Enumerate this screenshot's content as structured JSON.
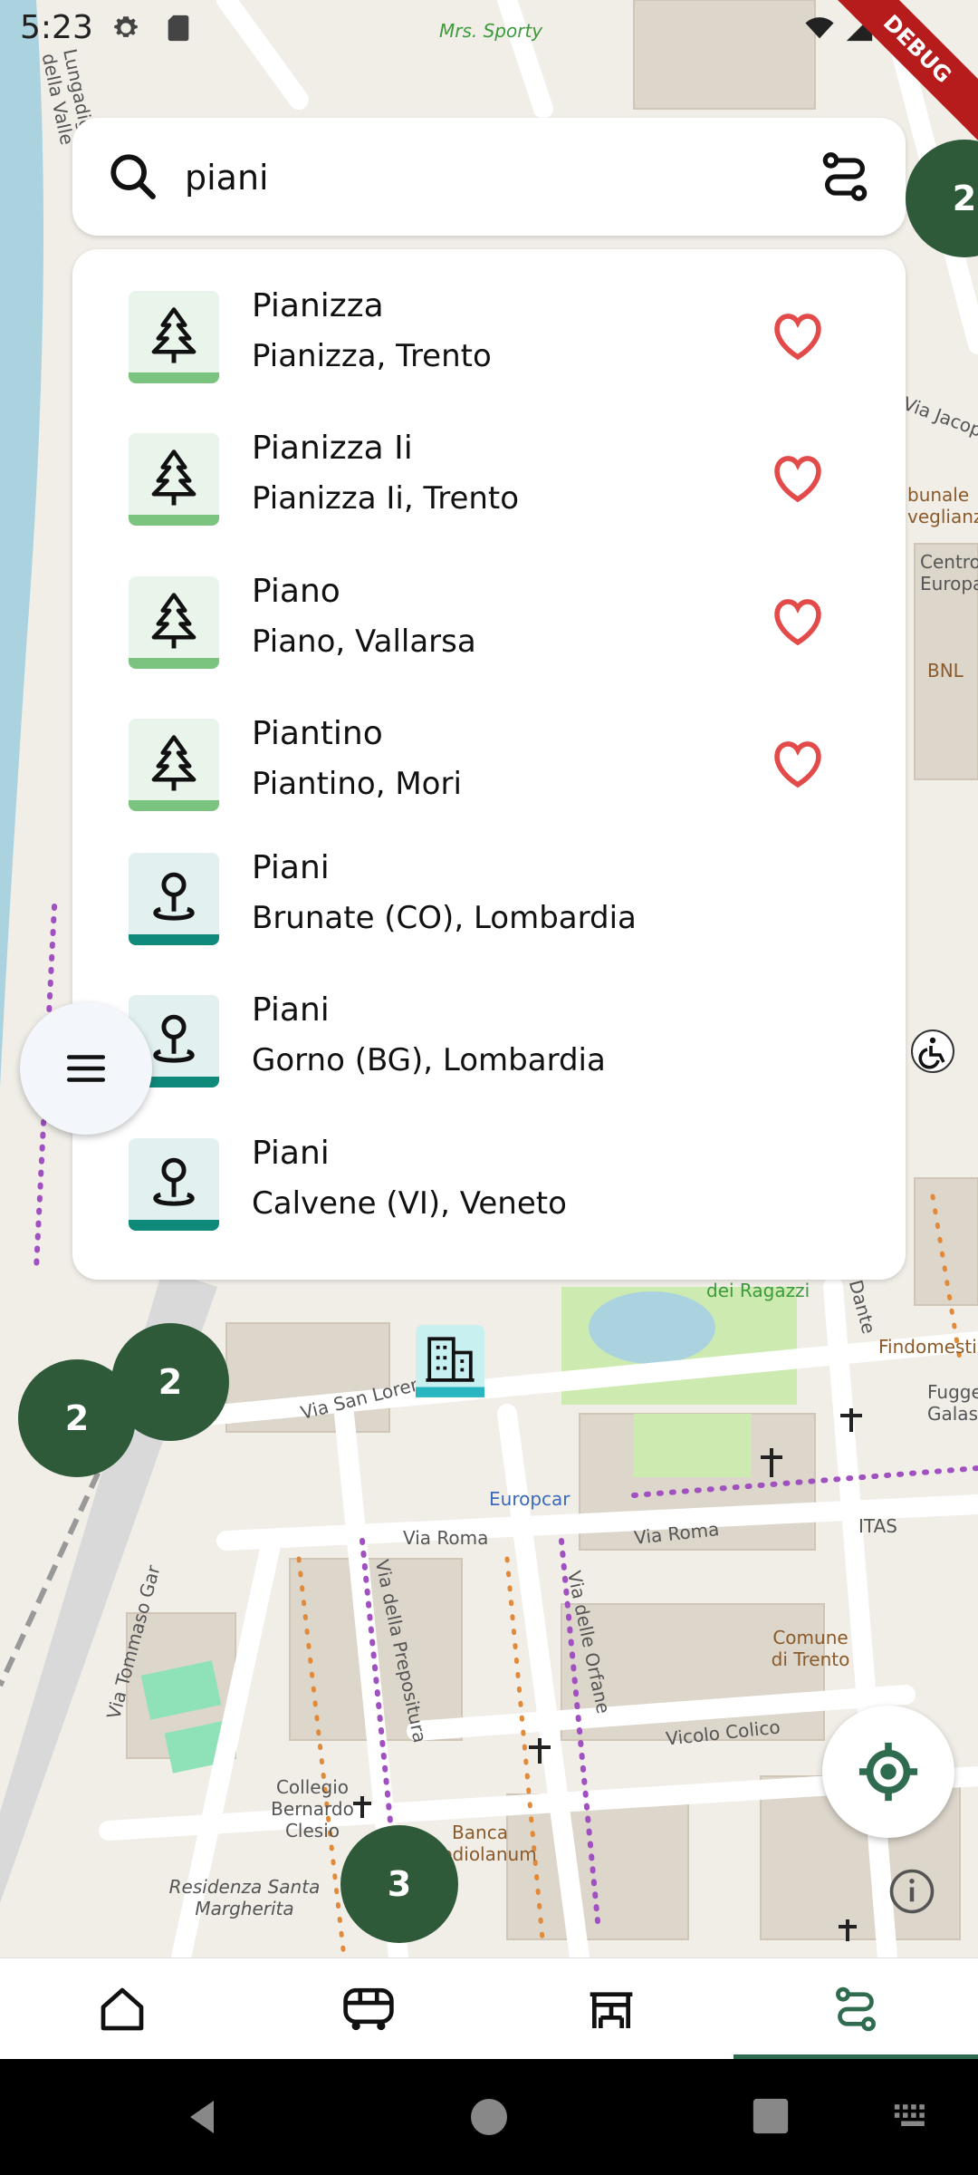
{
  "status_bar": {
    "time": "5:23",
    "icons": [
      "gear-icon",
      "sd-card-icon",
      "wifi-icon",
      "signal-icon"
    ],
    "debug_label": "DEBUG"
  },
  "search": {
    "value": "piani",
    "placeholder": ""
  },
  "results": [
    {
      "title": "Pianizza",
      "subtitle": "Pianizza, Trento",
      "type": "tree-icon",
      "favorite": true
    },
    {
      "title": "Pianizza Ii",
      "subtitle": "Pianizza Ii, Trento",
      "type": "tree-icon",
      "favorite": true
    },
    {
      "title": "Piano",
      "subtitle": "Piano, Vallarsa",
      "type": "tree-icon",
      "favorite": true
    },
    {
      "title": "Piantino",
      "subtitle": "Piantino, Mori",
      "type": "tree-icon",
      "favorite": true
    },
    {
      "title": "Piani",
      "subtitle": "Brunate (CO), Lombardia",
      "type": "pin-icon",
      "favorite": false
    },
    {
      "title": "Piani",
      "subtitle": "Gorno (BG), Lombardia",
      "type": "pin-icon",
      "favorite": false
    },
    {
      "title": "Piani",
      "subtitle": "Calvene (VI), Veneto",
      "type": "pin-icon",
      "favorite": false
    }
  ],
  "clusters": {
    "top_right": "2",
    "left_a": "2",
    "left_b": "2",
    "bottom": "3"
  },
  "map_labels": {
    "l1": "Mrs. Sporty",
    "l2": "Via San Lorenzo",
    "l3": "Via Roma",
    "l4": "Via Roma",
    "l5": "Europcar",
    "l6": "Via della Prepositura",
    "l7": "Via delle Orfane",
    "l8": "Vicolo Colico",
    "l9": "Collegio Bernardo Clesio",
    "l10": "Banca Mediolanum",
    "l11": "Residenza Santa Margherita",
    "l12": "Comune di Trento",
    "l13": "ITAS",
    "l14": "Findomestic",
    "l15": "Via Tommaso Gar",
    "l16": "dei Ragazzi",
    "l17": "Dante",
    "l18": "Centro Europa",
    "l19": "Fugge Galass",
    "l20": "BNL",
    "l21": "bunale veglianza",
    "l22": "Via Jacopo",
    "l23": "Lungadige Ciclovia della Valle"
  },
  "colors": {
    "accent": "#2e6b4f",
    "cluster": "#2f5a3a",
    "heart": "#e34b4b",
    "tree_bar": "#7bc47f",
    "pin_bar": "#0f8a7a"
  },
  "bottom_nav": [
    "home-icon",
    "bus-icon",
    "bench-icon",
    "route-icon"
  ]
}
